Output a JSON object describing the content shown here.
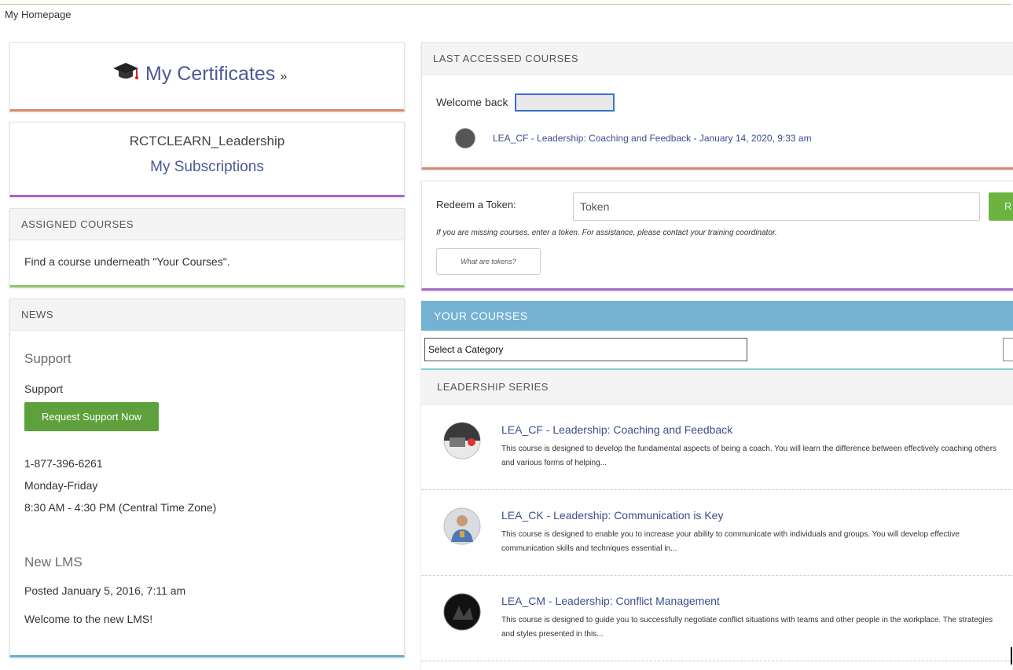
{
  "breadcrumb": "My Homepage",
  "certificates": {
    "label": "My Certificates",
    "arrow": "»"
  },
  "subscriptions": {
    "name": "RCTCLEARN_Leadership",
    "link": "My Subscriptions"
  },
  "assigned": {
    "header": "ASSIGNED COURSES",
    "text": "Find a course underneath \"Your Courses\"."
  },
  "news": {
    "header": "NEWS",
    "support_heading": "Support",
    "support_text": "Support",
    "support_button": "Request Support Now",
    "phone": "1-877-396-6261",
    "days": "Monday-Friday",
    "hours": "8:30 AM - 4:30 PM (Central Time Zone)",
    "lms_heading": "New LMS",
    "lms_posted": "Posted January 5, 2016, 7:11 am",
    "lms_text": "Welcome to the new LMS!"
  },
  "last_accessed": {
    "header": "LAST ACCESSED COURSES",
    "welcome": "Welcome back",
    "course_link": "LEA_CF - Leadership: Coaching and Feedback - January 14, 2020, 9:33 am"
  },
  "token": {
    "label": "Redeem a Token:",
    "placeholder": "Token",
    "button": "R",
    "help": "If you are missing courses, enter a token. For assistance, please contact your training coordinator.",
    "what_button": "What are tokens?"
  },
  "your_courses": {
    "header": "YOUR COURSES",
    "category_select": "Select a Category",
    "series_header": "LEADERSHIP SERIES",
    "courses": [
      {
        "title": "LEA_CF - Leadership: Coaching and Feedback",
        "desc": "This course is designed to develop the fundamental aspects of being a coach. You will learn the difference between effectively coaching others and various forms of helping..."
      },
      {
        "title": "LEA_CK - Leadership: Communication is Key",
        "desc": "This course is designed to enable you to increase your ability to communicate with individuals and groups. You will develop effective communication skills and techniques essential in..."
      },
      {
        "title": "LEA_CM - Leadership: Conflict Management",
        "desc": "This course is designed to guide you to successfully negotiate conflict situations with teams and other people in the workplace. The strategies and styles presented in this..."
      }
    ]
  }
}
